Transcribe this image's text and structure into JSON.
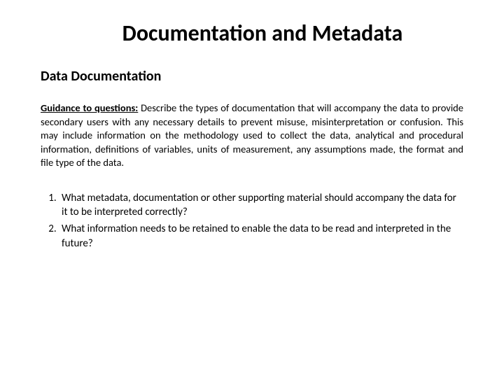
{
  "title": "Documentation and Metadata",
  "section": "Data Documentation",
  "guidance": {
    "lead": "Guidance to questions:",
    "body": " Describe the types of documentation that will accompany the data to provide secondary users with any necessary details to prevent misuse, misinterpretation or confusion. This may include information on the methodology used to collect the data, analytical and procedural information, definitions of variables, units of measurement, any assumptions made, the format and file type of the data."
  },
  "questions": [
    "What metadata, documentation or other supporting material should accompany the data for it to be interpreted correctly?",
    "What information needs to be retained to enable the data to be read and interpreted in the future?"
  ]
}
